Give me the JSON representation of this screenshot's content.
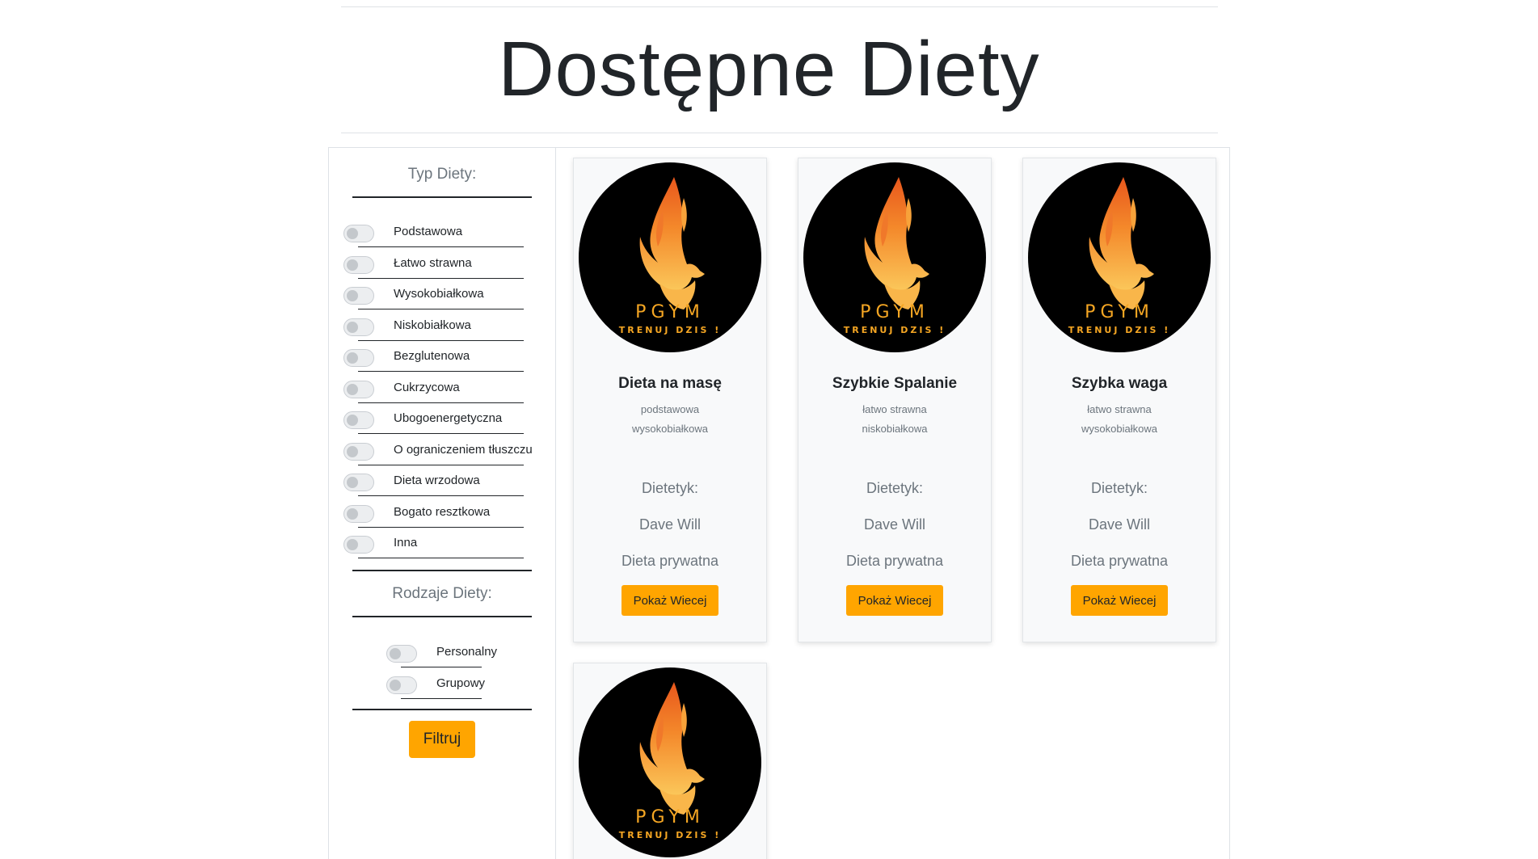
{
  "page": {
    "title": "Dostępne Diety"
  },
  "sidebar": {
    "diet_type_heading": "Typ Diety:",
    "diet_types": [
      {
        "label": "Podstawowa",
        "checked": false
      },
      {
        "label": "Łatwo strawna",
        "checked": false
      },
      {
        "label": "Wysokobiałkowa",
        "checked": false
      },
      {
        "label": "Niskobiałkowa",
        "checked": false
      },
      {
        "label": "Bezglutenowa",
        "checked": false
      },
      {
        "label": "Cukrzycowa",
        "checked": false
      },
      {
        "label": "Ubogoenergetyczna",
        "checked": false
      },
      {
        "label": "O ograniczeniem tłuszczu",
        "checked": false
      },
      {
        "label": "Dieta wrzodowa",
        "checked": false
      },
      {
        "label": "Bogato resztkowa",
        "checked": false
      },
      {
        "label": "Inna",
        "checked": false
      }
    ],
    "diet_kind_heading": "Rodzaje Diety:",
    "diet_kinds": [
      {
        "label": "Personalny",
        "checked": false
      },
      {
        "label": "Grupowy",
        "checked": false
      }
    ],
    "filter_button": "Filtruj"
  },
  "cards": [
    {
      "logo": {
        "brand": "PGYM",
        "tagline": "TRENUJ DZIS !"
      },
      "title": "Dieta na masę",
      "tags": [
        "podstawowa",
        "wysokobiałkowa"
      ],
      "dietitian_label": "Dietetyk:",
      "dietitian_name": "Dave Will",
      "privacy": "Dieta prywatna",
      "button": "Pokaż Wiecej"
    },
    {
      "logo": {
        "brand": "PGYM",
        "tagline": "TRENUJ DZIS !"
      },
      "title": "Szybkie Spalanie",
      "tags": [
        "łatwo strawna",
        "niskobiałkowa"
      ],
      "dietitian_label": "Dietetyk:",
      "dietitian_name": "Dave Will",
      "privacy": "Dieta prywatna",
      "button": "Pokaż Wiecej"
    },
    {
      "logo": {
        "brand": "PGYM",
        "tagline": "TRENUJ DZIS !"
      },
      "title": "Szybka waga",
      "tags": [
        "łatwo strawna",
        "wysokobiałkowa"
      ],
      "dietitian_label": "Dietetyk:",
      "dietitian_name": "Dave Will",
      "privacy": "Dieta prywatna",
      "button": "Pokaż Wiecej"
    },
    {
      "logo": {
        "brand": "PGYM",
        "tagline": "TRENUJ DZIS !"
      }
    }
  ],
  "colors": {
    "accent": "#ffa500",
    "logo_background": "#000000",
    "logo_gold": "#f5a623"
  }
}
